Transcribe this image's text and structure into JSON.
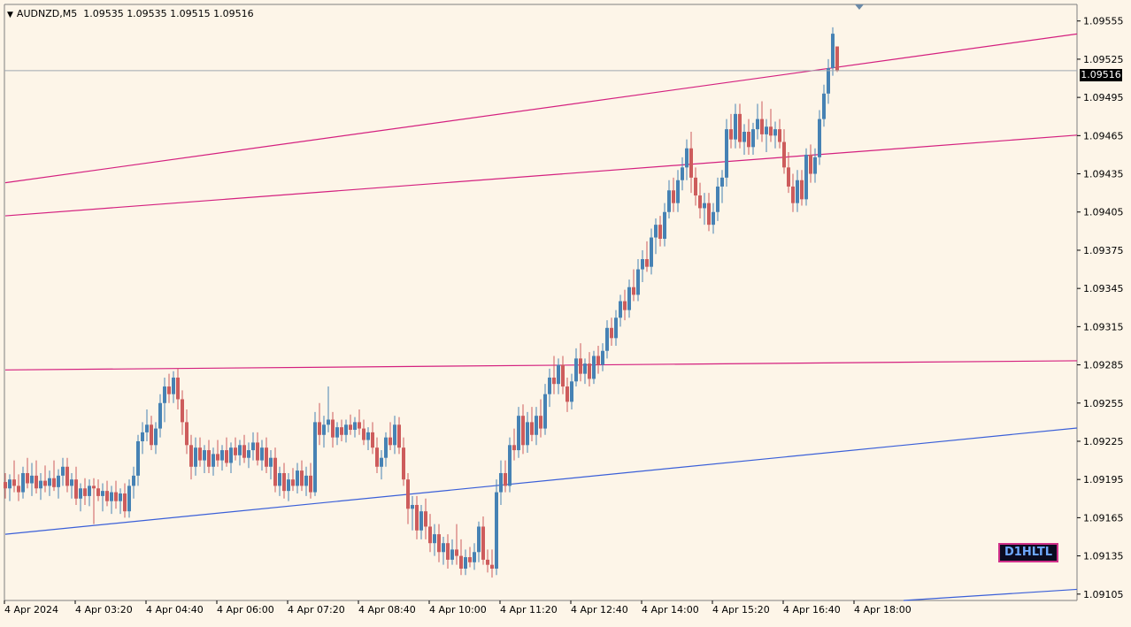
{
  "header": {
    "symbol": "AUDNZD,M5",
    "ohlc": "1.09535 1.09535 1.09515 1.09516"
  },
  "current_price_tag": "1.09516",
  "indicator_badge": "D1HLTL",
  "colors": {
    "background": "#fdf5e8",
    "bull": "#4682b4",
    "bear": "#cd5c5c",
    "magenta_line": "#d4207f",
    "blue_line": "#3a5fd8",
    "price_line": "#a0a8b0"
  },
  "chart_data": {
    "type": "candlestick",
    "symbol": "AUDNZD",
    "timeframe": "M5",
    "y_ticks": [
      "1.09555",
      "1.09525",
      "1.09495",
      "1.09465",
      "1.09435",
      "1.09405",
      "1.09375",
      "1.09345",
      "1.09315",
      "1.09285",
      "1.09255",
      "1.09225",
      "1.09195",
      "1.09165",
      "1.09135",
      "1.09105"
    ],
    "x_ticks": [
      "4 Apr 2024",
      "4 Apr 03:20",
      "4 Apr 04:40",
      "4 Apr 06:00",
      "4 Apr 07:20",
      "4 Apr 08:40",
      "4 Apr 10:00",
      "4 Apr 11:20",
      "4 Apr 12:40",
      "4 Apr 14:00",
      "4 Apr 15:20",
      "4 Apr 16:40",
      "4 Apr 18:00"
    ],
    "ylim": [
      1.091,
      1.09568
    ],
    "current_price": 1.09516,
    "candles_per_tick": 16,
    "trend_lines": [
      {
        "color": "magenta",
        "from": {
          "bar": 0,
          "price": 1.09428
        },
        "to": {
          "bar": 284,
          "price": 1.09565
        }
      },
      {
        "color": "magenta",
        "from": {
          "bar": 0,
          "price": 1.09402
        },
        "to": {
          "bar": 302,
          "price": 1.09481
        }
      },
      {
        "color": "magenta",
        "from": {
          "bar": 0,
          "price": 1.09281
        },
        "to": {
          "bar": 302,
          "price": 1.0929
        }
      },
      {
        "color": "blue",
        "from": {
          "bar": 0,
          "price": 1.09152
        },
        "to": {
          "bar": 302,
          "price": 1.09256
        }
      },
      {
        "color": "blue",
        "from": {
          "bar": 203,
          "price": 1.091
        },
        "to": {
          "bar": 302,
          "price": 1.09122
        }
      }
    ],
    "candles": [
      [
        1.09193,
        1.092,
        1.0918,
        1.09188
      ],
      [
        1.09188,
        1.09199,
        1.09178,
        1.09195
      ],
      [
        1.09195,
        1.0921,
        1.09185,
        1.0919
      ],
      [
        1.0919,
        1.09199,
        1.09178,
        1.09185
      ],
      [
        1.09185,
        1.09205,
        1.0918,
        1.092
      ],
      [
        1.092,
        1.09212,
        1.09188,
        1.09192
      ],
      [
        1.09192,
        1.09208,
        1.09182,
        1.09198
      ],
      [
        1.09198,
        1.0921,
        1.09184,
        1.09188
      ],
      [
        1.09188,
        1.092,
        1.09179,
        1.09194
      ],
      [
        1.09194,
        1.09206,
        1.09185,
        1.0919
      ],
      [
        1.0919,
        1.09202,
        1.09182,
        1.09196
      ],
      [
        1.09196,
        1.0921,
        1.09186,
        1.09189
      ],
      [
        1.09189,
        1.09203,
        1.0918,
        1.09198
      ],
      [
        1.09198,
        1.09212,
        1.0919,
        1.09205
      ],
      [
        1.09205,
        1.09212,
        1.09185,
        1.0919
      ],
      [
        1.0919,
        1.092,
        1.0918,
        1.09195
      ],
      [
        1.09195,
        1.09205,
        1.09175,
        1.0918
      ],
      [
        1.0918,
        1.09192,
        1.0917,
        1.09188
      ],
      [
        1.09188,
        1.09196,
        1.09175,
        1.09182
      ],
      [
        1.09182,
        1.09195,
        1.09174,
        1.0919
      ],
      [
        1.0919,
        1.09196,
        1.0916,
        1.09188
      ],
      [
        1.09188,
        1.09195,
        1.09178,
        1.09182
      ],
      [
        1.09182,
        1.09192,
        1.0917,
        1.09186
      ],
      [
        1.09186,
        1.09194,
        1.09174,
        1.09178
      ],
      [
        1.09178,
        1.0919,
        1.09168,
        1.09185
      ],
      [
        1.09185,
        1.09194,
        1.09172,
        1.09178
      ],
      [
        1.09178,
        1.09188,
        1.09168,
        1.09184
      ],
      [
        1.09184,
        1.09192,
        1.09165,
        1.0917
      ],
      [
        1.0917,
        1.09195,
        1.09165,
        1.0919
      ],
      [
        1.0919,
        1.09205,
        1.0918,
        1.09198
      ],
      [
        1.09198,
        1.0923,
        1.0919,
        1.09225
      ],
      [
        1.09225,
        1.0924,
        1.09215,
        1.09232
      ],
      [
        1.09232,
        1.0925,
        1.09225,
        1.09238
      ],
      [
        1.09238,
        1.09245,
        1.09218,
        1.09222
      ],
      [
        1.09222,
        1.0924,
        1.09215,
        1.09235
      ],
      [
        1.09235,
        1.09262,
        1.09228,
        1.09255
      ],
      [
        1.09255,
        1.09275,
        1.0924,
        1.09268
      ],
      [
        1.09268,
        1.09278,
        1.09255,
        1.09262
      ],
      [
        1.09262,
        1.0928,
        1.09255,
        1.09275
      ],
      [
        1.09275,
        1.09282,
        1.0925,
        1.09258
      ],
      [
        1.09258,
        1.09265,
        1.0923,
        1.0924
      ],
      [
        1.0924,
        1.0925,
        1.09215,
        1.09222
      ],
      [
        1.09222,
        1.0923,
        1.09195,
        1.09205
      ],
      [
        1.09205,
        1.09228,
        1.09198,
        1.0922
      ],
      [
        1.0922,
        1.09228,
        1.09205,
        1.0921
      ],
      [
        1.0921,
        1.09222,
        1.092,
        1.09218
      ],
      [
        1.09218,
        1.09226,
        1.092,
        1.09205
      ],
      [
        1.09205,
        1.0922,
        1.09198,
        1.09215
      ],
      [
        1.09215,
        1.09226,
        1.09205,
        1.0921
      ],
      [
        1.0921,
        1.09222,
        1.09202,
        1.09218
      ],
      [
        1.09218,
        1.09228,
        1.09205,
        1.09208
      ],
      [
        1.09208,
        1.09224,
        1.092,
        1.0922
      ],
      [
        1.0922,
        1.09228,
        1.0921,
        1.09214
      ],
      [
        1.09214,
        1.09226,
        1.09206,
        1.09222
      ],
      [
        1.09222,
        1.0923,
        1.09208,
        1.09212
      ],
      [
        1.09212,
        1.09224,
        1.09204,
        1.09218
      ],
      [
        1.09218,
        1.09232,
        1.0921,
        1.09224
      ],
      [
        1.09224,
        1.09232,
        1.09206,
        1.0921
      ],
      [
        1.0921,
        1.09226,
        1.09202,
        1.0922
      ],
      [
        1.0922,
        1.09228,
        1.092,
        1.09205
      ],
      [
        1.09205,
        1.09218,
        1.09195,
        1.09212
      ],
      [
        1.09212,
        1.0922,
        1.09185,
        1.0919
      ],
      [
        1.0919,
        1.09205,
        1.09182,
        1.092
      ],
      [
        1.092,
        1.09208,
        1.0918,
        1.09186
      ],
      [
        1.09186,
        1.092,
        1.09178,
        1.09195
      ],
      [
        1.09195,
        1.09204,
        1.09186,
        1.0919
      ],
      [
        1.0919,
        1.09208,
        1.09184,
        1.09202
      ],
      [
        1.09202,
        1.0921,
        1.09186,
        1.0919
      ],
      [
        1.0919,
        1.09205,
        1.09182,
        1.09198
      ],
      [
        1.09198,
        1.09208,
        1.0918,
        1.09185
      ],
      [
        1.09185,
        1.09248,
        1.09182,
        1.0924
      ],
      [
        1.0924,
        1.09255,
        1.09222,
        1.0923
      ],
      [
        1.0923,
        1.09245,
        1.0922,
        1.09238
      ],
      [
        1.09238,
        1.09268,
        1.09232,
        1.09242
      ],
      [
        1.09242,
        1.09248,
        1.0922,
        1.09228
      ],
      [
        1.09228,
        1.0924,
        1.09222,
        1.09236
      ],
      [
        1.09236,
        1.09242,
        1.09225,
        1.0923
      ],
      [
        1.0923,
        1.09242,
        1.09224,
        1.09238
      ],
      [
        1.09238,
        1.09246,
        1.0923,
        1.09234
      ],
      [
        1.09234,
        1.09244,
        1.09228,
        1.0924
      ],
      [
        1.0924,
        1.0925,
        1.0923,
        1.09235
      ],
      [
        1.09235,
        1.09242,
        1.09222,
        1.09226
      ],
      [
        1.09226,
        1.09236,
        1.09218,
        1.09232
      ],
      [
        1.09232,
        1.0924,
        1.09215,
        1.0922
      ],
      [
        1.0922,
        1.09228,
        1.092,
        1.09205
      ],
      [
        1.09205,
        1.09218,
        1.09195,
        1.09212
      ],
      [
        1.09212,
        1.09232,
        1.09205,
        1.09228
      ],
      [
        1.09228,
        1.0924,
        1.09218,
        1.09222
      ],
      [
        1.09222,
        1.09245,
        1.09215,
        1.09238
      ],
      [
        1.09238,
        1.09244,
        1.09215,
        1.0922
      ],
      [
        1.0922,
        1.09228,
        1.0919,
        1.09195
      ],
      [
        1.09195,
        1.092,
        1.0916,
        1.09172
      ],
      [
        1.09172,
        1.09182,
        1.09155,
        1.09175
      ],
      [
        1.09175,
        1.09182,
        1.09148,
        1.09155
      ],
      [
        1.09155,
        1.09175,
        1.09148,
        1.0917
      ],
      [
        1.0917,
        1.0918,
        1.09148,
        1.09158
      ],
      [
        1.09158,
        1.09168,
        1.09138,
        1.09145
      ],
      [
        1.09145,
        1.0916,
        1.09135,
        1.09152
      ],
      [
        1.09152,
        1.0916,
        1.0913,
        1.09138
      ],
      [
        1.09138,
        1.0915,
        1.09128,
        1.09145
      ],
      [
        1.09145,
        1.09152,
        1.09125,
        1.09132
      ],
      [
        1.09132,
        1.09148,
        1.09128,
        1.0914
      ],
      [
        1.0914,
        1.0916,
        1.09128,
        1.09135
      ],
      [
        1.09135,
        1.09148,
        1.0912,
        1.09125
      ],
      [
        1.09125,
        1.0914,
        1.0912,
        1.09134
      ],
      [
        1.09134,
        1.09142,
        1.09126,
        1.0913
      ],
      [
        1.0913,
        1.09145,
        1.09124,
        1.09138
      ],
      [
        1.09138,
        1.09162,
        1.0913,
        1.09158
      ],
      [
        1.09158,
        1.09166,
        1.09128,
        1.09132
      ],
      [
        1.09132,
        1.0914,
        1.09122,
        1.09128
      ],
      [
        1.09128,
        1.0914,
        1.09118,
        1.09125
      ],
      [
        1.09125,
        1.09195,
        1.0912,
        1.09185
      ],
      [
        1.09185,
        1.0921,
        1.09175,
        1.092
      ],
      [
        1.092,
        1.0921,
        1.09185,
        1.0919
      ],
      [
        1.0919,
        1.09228,
        1.09185,
        1.09222
      ],
      [
        1.09222,
        1.09235,
        1.0921,
        1.09218
      ],
      [
        1.09218,
        1.09252,
        1.09212,
        1.09245
      ],
      [
        1.09245,
        1.09254,
        1.09215,
        1.09222
      ],
      [
        1.09222,
        1.09248,
        1.09216,
        1.0924
      ],
      [
        1.0924,
        1.09252,
        1.09225,
        1.0923
      ],
      [
        1.0923,
        1.09252,
        1.09222,
        1.09245
      ],
      [
        1.09245,
        1.09258,
        1.09228,
        1.09235
      ],
      [
        1.09235,
        1.0927,
        1.0923,
        1.09262
      ],
      [
        1.09262,
        1.09282,
        1.09252,
        1.09275
      ],
      [
        1.09275,
        1.09292,
        1.09262,
        1.0927
      ],
      [
        1.0927,
        1.0929,
        1.09262,
        1.09285
      ],
      [
        1.09285,
        1.09292,
        1.09262,
        1.09268
      ],
      [
        1.09268,
        1.09275,
        1.09248,
        1.09256
      ],
      [
        1.09256,
        1.09278,
        1.0925,
        1.09272
      ],
      [
        1.09272,
        1.09298,
        1.09268,
        1.0929
      ],
      [
        1.0929,
        1.09302,
        1.09272,
        1.09278
      ],
      [
        1.09278,
        1.0929,
        1.0927,
        1.09286
      ],
      [
        1.09286,
        1.09295,
        1.09268,
        1.09274
      ],
      [
        1.09274,
        1.09296,
        1.0927,
        1.09292
      ],
      [
        1.09292,
        1.093,
        1.09278,
        1.09285
      ],
      [
        1.09285,
        1.09302,
        1.0928,
        1.09296
      ],
      [
        1.09296,
        1.0932,
        1.0929,
        1.09314
      ],
      [
        1.09314,
        1.09322,
        1.093,
        1.09306
      ],
      [
        1.09306,
        1.09328,
        1.093,
        1.09322
      ],
      [
        1.09322,
        1.0934,
        1.09315,
        1.09335
      ],
      [
        1.09335,
        1.09344,
        1.0932,
        1.09328
      ],
      [
        1.09328,
        1.09352,
        1.09322,
        1.09346
      ],
      [
        1.09346,
        1.0936,
        1.09335,
        1.0934
      ],
      [
        1.0934,
        1.09368,
        1.09335,
        1.0936
      ],
      [
        1.0936,
        1.09375,
        1.0935,
        1.09368
      ],
      [
        1.09368,
        1.09382,
        1.09358,
        1.09362
      ],
      [
        1.09362,
        1.09392,
        1.09356,
        1.09385
      ],
      [
        1.09385,
        1.094,
        1.09372,
        1.09395
      ],
      [
        1.09395,
        1.09402,
        1.09378,
        1.09384
      ],
      [
        1.09384,
        1.09412,
        1.09378,
        1.09405
      ],
      [
        1.09405,
        1.0943,
        1.094,
        1.09422
      ],
      [
        1.09422,
        1.09432,
        1.09405,
        1.09412
      ],
      [
        1.09412,
        1.09438,
        1.09405,
        1.0943
      ],
      [
        1.0943,
        1.09448,
        1.09422,
        1.0944
      ],
      [
        1.0944,
        1.09462,
        1.0943,
        1.09455
      ],
      [
        1.09455,
        1.09468,
        1.0942,
        1.09432
      ],
      [
        1.09432,
        1.0944,
        1.0941,
        1.09418
      ],
      [
        1.09418,
        1.09428,
        1.094,
        1.09408
      ],
      [
        1.09408,
        1.0942,
        1.09395,
        1.09412
      ],
      [
        1.09412,
        1.0942,
        1.0939,
        1.09395
      ],
      [
        1.09395,
        1.09412,
        1.09388,
        1.09405
      ],
      [
        1.09405,
        1.09432,
        1.09398,
        1.09425
      ],
      [
        1.09425,
        1.09438,
        1.09412,
        1.09432
      ],
      [
        1.09432,
        1.09478,
        1.09425,
        1.0947
      ],
      [
        1.0947,
        1.09482,
        1.09455,
        1.09462
      ],
      [
        1.09462,
        1.0949,
        1.09455,
        1.09482
      ],
      [
        1.09482,
        1.0949,
        1.09455,
        1.0946
      ],
      [
        1.0946,
        1.09474,
        1.0945,
        1.09468
      ],
      [
        1.09468,
        1.09478,
        1.0945,
        1.09456
      ],
      [
        1.09456,
        1.09475,
        1.0945,
        1.0947
      ],
      [
        1.0947,
        1.0949,
        1.09462,
        1.09478
      ],
      [
        1.09478,
        1.09492,
        1.0946,
        1.09466
      ],
      [
        1.09466,
        1.09478,
        1.09452,
        1.09472
      ],
      [
        1.09472,
        1.09486,
        1.0946,
        1.09465
      ],
      [
        1.09465,
        1.09476,
        1.09455,
        1.0947
      ],
      [
        1.0947,
        1.09478,
        1.09455,
        1.0946
      ],
      [
        1.0946,
        1.0947,
        1.09435,
        1.0944
      ],
      [
        1.0944,
        1.09452,
        1.0942,
        1.09425
      ],
      [
        1.09425,
        1.09435,
        1.09405,
        1.09412
      ],
      [
        1.09412,
        1.09438,
        1.09405,
        1.0943
      ],
      [
        1.0943,
        1.09438,
        1.0941,
        1.09415
      ],
      [
        1.09415,
        1.09455,
        1.0941,
        1.0945
      ],
      [
        1.0945,
        1.09458,
        1.09428,
        1.09435
      ],
      [
        1.09435,
        1.09455,
        1.09428,
        1.09448
      ],
      [
        1.09448,
        1.09485,
        1.09442,
        1.09478
      ],
      [
        1.09478,
        1.09505,
        1.09472,
        1.09498
      ],
      [
        1.09498,
        1.09525,
        1.0949,
        1.09518
      ],
      [
        1.09518,
        1.0955,
        1.09512,
        1.09545
      ],
      [
        1.09535,
        1.09535,
        1.09515,
        1.09516
      ]
    ]
  }
}
